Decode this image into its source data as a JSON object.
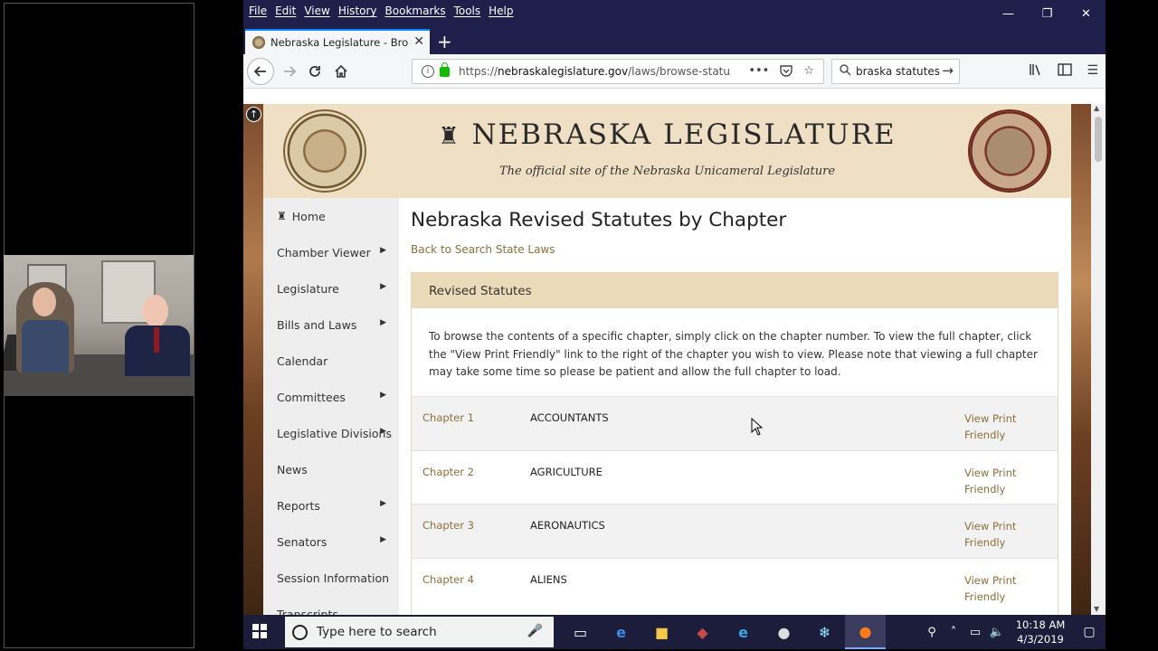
{
  "menubar": {
    "items": [
      "File",
      "Edit",
      "View",
      "History",
      "Bookmarks",
      "Tools",
      "Help"
    ]
  },
  "window_controls": {
    "minimize": "—",
    "restore": "❐",
    "close": "✕"
  },
  "tab": {
    "title": "Nebraska Legislature - Browse",
    "close": "✕",
    "new_tab": "+"
  },
  "address": {
    "prefix": "https://",
    "domain": "nebraskalegislature.gov",
    "path": "/laws/browse-statute"
  },
  "search": {
    "query": "braska statutes"
  },
  "site": {
    "title": "NEBRASKA LEGISLATURE",
    "subtitle": "The official site of the Nebraska Unicameral Legislature",
    "scroll_top": "↑"
  },
  "sidebar": {
    "items": [
      {
        "label": "Home",
        "caret": false
      },
      {
        "label": "Chamber Viewer",
        "caret": true
      },
      {
        "label": "Legislature",
        "caret": true
      },
      {
        "label": "Bills and Laws",
        "caret": true
      },
      {
        "label": "Calendar",
        "caret": false
      },
      {
        "label": "Committees",
        "caret": true
      },
      {
        "label": "Legislative Divisions",
        "caret": true
      },
      {
        "label": "News",
        "caret": false
      },
      {
        "label": "Reports",
        "caret": true
      },
      {
        "label": "Senators",
        "caret": true
      },
      {
        "label": "Session Information",
        "caret": false
      },
      {
        "label": "Transcripts",
        "caret": false
      }
    ]
  },
  "main": {
    "title": "Nebraska Revised Statutes by Chapter",
    "back_link": "Back to Search State Laws",
    "panel_title": "Revised Statutes",
    "instructions": "To browse the contents of a specific chapter, simply click on the chapter number. To view the full chapter, click the \"View Print Friendly\" link to the right of the chapter you wish to view. Please note that viewing a full chapter may take some time so please be patient and allow the full chapter to load.",
    "chapters": [
      {
        "num": "Chapter 1",
        "name": "ACCOUNTANTS",
        "print": "View Print Friendly"
      },
      {
        "num": "Chapter 2",
        "name": "AGRICULTURE",
        "print": "View Print Friendly"
      },
      {
        "num": "Chapter 3",
        "name": "AERONAUTICS",
        "print": "View Print Friendly"
      },
      {
        "num": "Chapter 4",
        "name": "ALIENS",
        "print": "View Print Friendly"
      }
    ]
  },
  "taskbar": {
    "search_placeholder": "Type here to search",
    "time": "10:18 AM",
    "date": "4/3/2019"
  }
}
